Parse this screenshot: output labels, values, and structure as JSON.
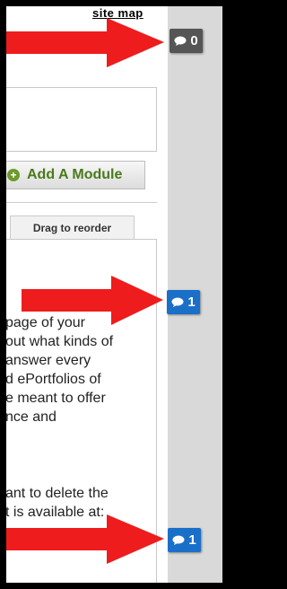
{
  "header": {
    "site_map_label": "site map"
  },
  "module": {
    "add_label": "Add A Module",
    "drag_label": "Drag to reorder"
  },
  "body_lines": [
    "page of your",
    "out what kinds of",
    "answer every",
    "d ePortfolios of",
    "e meant to offer",
    "nce and",
    "ant to delete the",
    "t is available at:"
  ],
  "comment_badges": [
    {
      "count": "0",
      "color": "#555555"
    },
    {
      "count": "1",
      "color": "#1a6fc9"
    },
    {
      "count": "1",
      "color": "#1a6fc9"
    }
  ],
  "colors": {
    "arrow": "#ee1c1c",
    "sidebar": "#d9d9d9",
    "add_text": "#4a7a1a"
  },
  "icons": [
    "comment-icon",
    "add-icon",
    "right-arrow"
  ]
}
